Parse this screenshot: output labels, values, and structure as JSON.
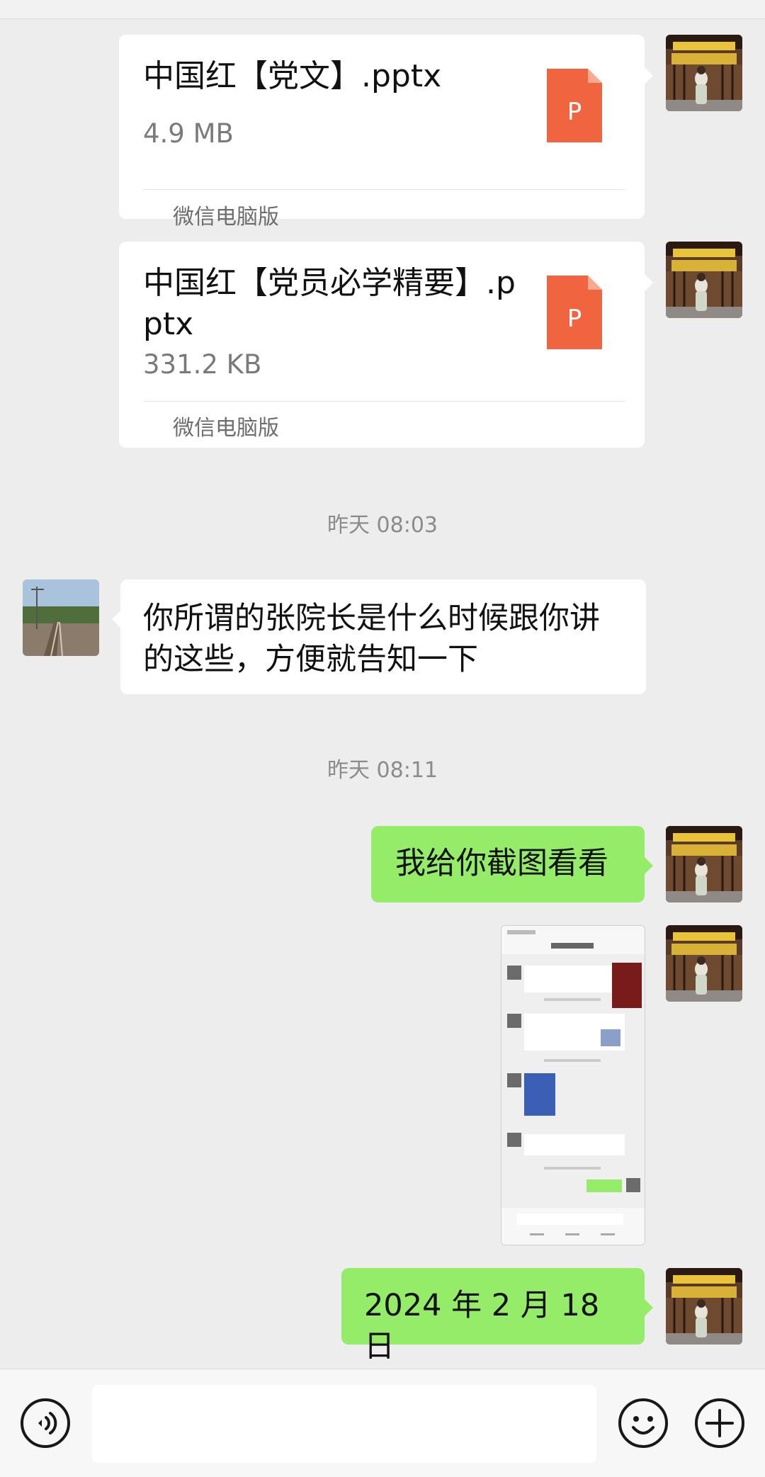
{
  "messages": {
    "file1": {
      "name": "中国红【党文】.pptx",
      "size": "4.9 MB",
      "source": "微信电脑版",
      "icon_letter": "P"
    },
    "file2": {
      "name": "中国红【党员必学精要】.pptx",
      "size": "331.2 KB",
      "source": "微信电脑版",
      "icon_letter": "P"
    },
    "time1": "昨天 08:03",
    "question": "你所谓的张院长是什么时候跟你讲的这些，方便就告知一下",
    "time2": "昨天 08:11",
    "reply1": "我给你截图看看",
    "reply2": "2024 年 2 月 18 日"
  },
  "input": {
    "placeholder": ""
  },
  "colors": {
    "background": "#ededed",
    "bubble_sent": "#95ec69",
    "bubble_received": "#ffffff",
    "ppt_icon": "#f0653f"
  }
}
